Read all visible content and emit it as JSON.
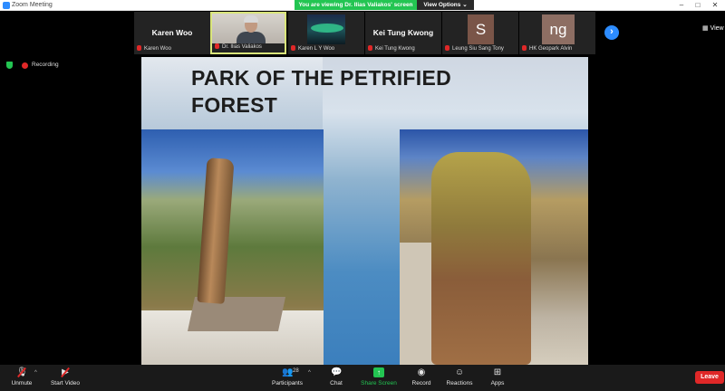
{
  "window": {
    "title": "Zoom Meeting"
  },
  "banner": {
    "viewing_text": "You are viewing Dr. Ilias Valiakos' screen",
    "view_options_label": "View Options ⌄"
  },
  "window_controls": {
    "minimize": "–",
    "maximize": "□",
    "close": "✕"
  },
  "participants_strip": [
    {
      "display": "Karen Woo",
      "label": "Karen Woo",
      "type": "name"
    },
    {
      "display": "",
      "label": "Dr. Ilias Valiakos",
      "type": "video",
      "active": true
    },
    {
      "display": "",
      "label": "Karen L Y Woo",
      "type": "aurora"
    },
    {
      "display": "Kei Tung Kwong",
      "label": "Kei Tung Kwong",
      "type": "name"
    },
    {
      "display": "S",
      "label": "Leung Siu Sang Tony",
      "type": "initial"
    },
    {
      "display": "ng",
      "label": "HK Geopark Alvin",
      "type": "initial"
    }
  ],
  "nav_next_icon": "›",
  "view_label": "View",
  "status": {
    "recording_label": "Recording"
  },
  "slide": {
    "title_line1": "PARK OF THE PETRIFIED",
    "title_line2": "FOREST"
  },
  "toolbar": {
    "unmute": "Unmute",
    "start_video": "Start Video",
    "participants": "Participants",
    "participants_count": "28",
    "chat": "Chat",
    "share_screen": "Share Screen",
    "record": "Record",
    "reactions": "Reactions",
    "apps": "Apps",
    "leave": "Leave"
  },
  "colors": {
    "accent_green": "#23c552",
    "leave_red": "#e02828",
    "zoom_blue": "#2d8cff"
  }
}
